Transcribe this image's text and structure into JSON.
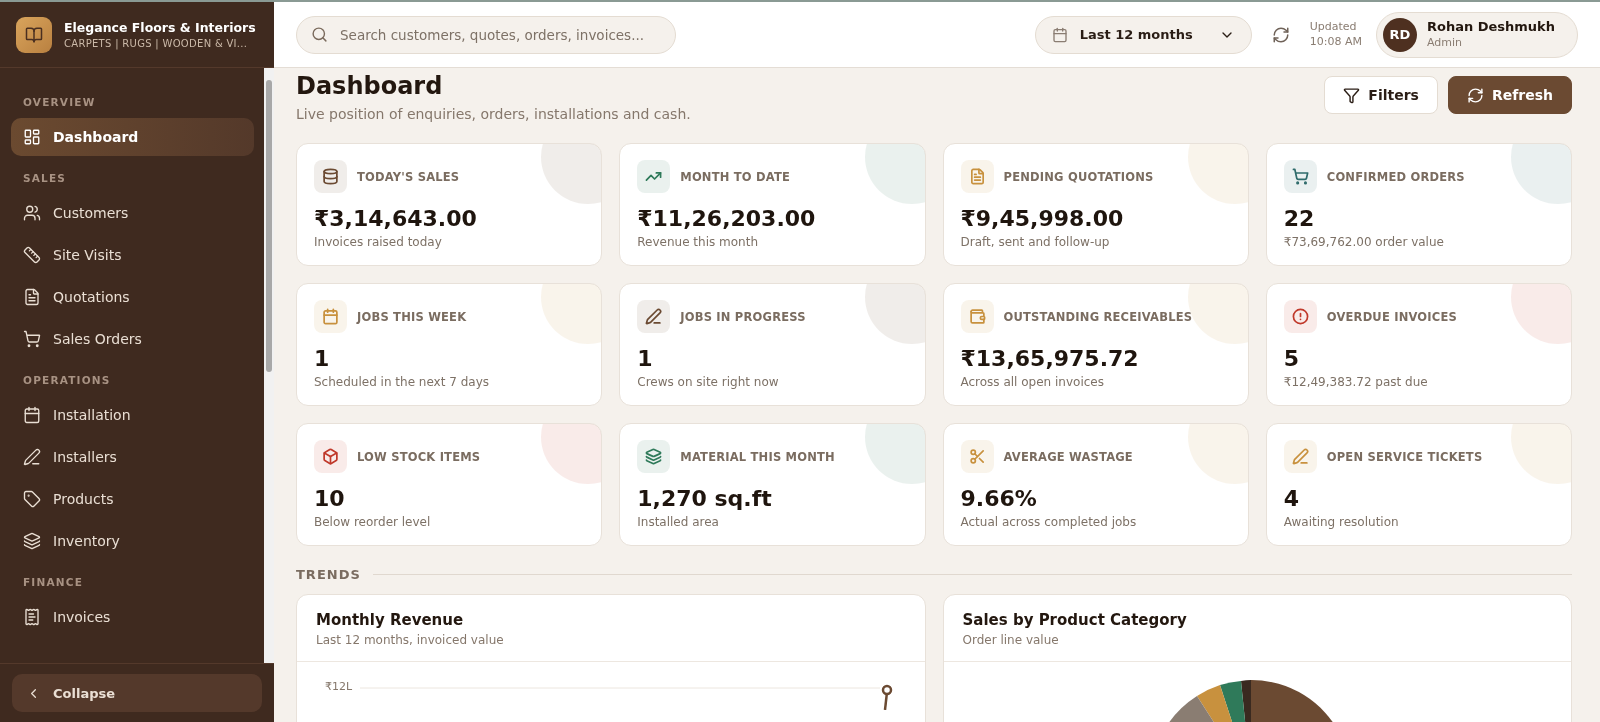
{
  "brand": {
    "name": "Elegance Floors & Interiors",
    "tagline": "CARPETS | RUGS | WOODEN & VI..."
  },
  "sidebar": {
    "sections": [
      {
        "title": "OVERVIEW",
        "items": [
          {
            "label": "Dashboard",
            "selected": true
          }
        ]
      },
      {
        "title": "SALES",
        "items": [
          {
            "label": "Customers",
            "selected": false
          },
          {
            "label": "Site Visits",
            "selected": false
          },
          {
            "label": "Quotations",
            "selected": false
          },
          {
            "label": "Sales Orders",
            "selected": false
          }
        ]
      },
      {
        "title": "OPERATIONS",
        "items": [
          {
            "label": "Installation",
            "selected": false
          },
          {
            "label": "Installers",
            "selected": false
          },
          {
            "label": "Products",
            "selected": false
          },
          {
            "label": "Inventory",
            "selected": false
          }
        ]
      },
      {
        "title": "FINANCE",
        "items": [
          {
            "label": "Invoices",
            "selected": false
          }
        ]
      }
    ],
    "collapse": "Collapse"
  },
  "topbar": {
    "search": {
      "placeholder": "Search customers, quotes, orders, invoices..."
    },
    "period": "Last 12 months",
    "updated_label": "Updated",
    "updated_time": "10:08 AM",
    "user": {
      "initials": "RD",
      "name": "Rohan Deshmukh",
      "role": "Admin"
    }
  },
  "page": {
    "title": "Dashboard",
    "subtitle": "Live position of enquiries, orders, installations and cash.",
    "buttons": [
      {
        "label": "Filters",
        "kind": "secondary"
      },
      {
        "label": "Refresh",
        "kind": "primary"
      }
    ]
  },
  "cards": [
    {
      "title": "TODAY'S SALES",
      "value": "₹3,14,643.00",
      "note": "Invoices raised today",
      "color": "#6b4a32"
    },
    {
      "title": "MONTH TO DATE",
      "value": "₹11,26,203.00",
      "note": "Revenue this month",
      "color": "#2f7a5a"
    },
    {
      "title": "PENDING QUOTATIONS",
      "value": "₹9,45,998.00",
      "note": "Draft, sent and follow-up",
      "color": "#c8913e"
    },
    {
      "title": "CONFIRMED ORDERS",
      "value": "22",
      "note": "₹73,69,762.00 order value",
      "color": "#2f6b6b"
    },
    {
      "title": "JOBS THIS WEEK",
      "value": "1",
      "note": "Scheduled in the next 7 days",
      "color": "#c8913e"
    },
    {
      "title": "JOBS IN PROGRESS",
      "value": "1",
      "note": "Crews on site right now",
      "color": "#6b4a32"
    },
    {
      "title": "OUTSTANDING RECEIVABLES",
      "value": "₹13,65,975.72",
      "note": "Across all open invoices",
      "color": "#c8913e"
    },
    {
      "title": "OVERDUE INVOICES",
      "value": "5",
      "note": "₹12,49,383.72 past due",
      "color": "#c0392b"
    },
    {
      "title": "LOW STOCK ITEMS",
      "value": "10",
      "note": "Below reorder level",
      "color": "#c0392b"
    },
    {
      "title": "MATERIAL THIS MONTH",
      "value": "1,270 sq.ft",
      "note": "Installed area",
      "color": "#2f7a5a"
    },
    {
      "title": "AVERAGE WASTAGE",
      "value": "9.66%",
      "note": "Actual across completed jobs",
      "color": "#c8913e"
    },
    {
      "title": "OPEN SERVICE TICKETS",
      "value": "4",
      "note": "Awaiting resolution",
      "color": "#c8913e"
    }
  ],
  "trends": {
    "heading": "TRENDS",
    "charts": [
      {
        "kind": "line",
        "title": "Monthly Revenue",
        "subtitle": "Last 12 months, invoiced value",
        "tick": "₹12L"
      },
      {
        "kind": "pie",
        "title": "Sales by Product Category",
        "subtitle": "Order line value"
      }
    ]
  }
}
